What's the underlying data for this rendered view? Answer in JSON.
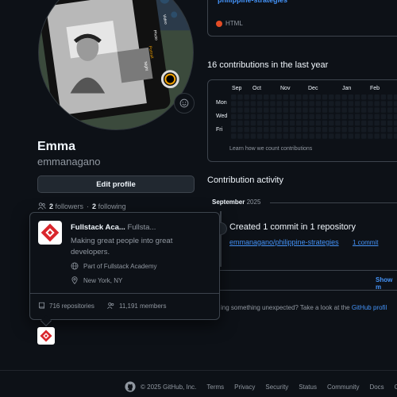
{
  "profile": {
    "name": "Emma",
    "login": "emmanagano",
    "edit_label": "Edit profile",
    "followers_count": "2",
    "followers_label": "followers",
    "separator": "·",
    "following_count": "2",
    "following_label": "following"
  },
  "camera": {
    "modes": [
      "Video",
      "Photo",
      "Portrait",
      "Night"
    ]
  },
  "popover": {
    "org_name": "Fullstack Aca...",
    "org_handle": "Fullsta...",
    "description": "Making great people into great developers.",
    "part_of": "Part of Fullstack Academy",
    "location": "New York, NY",
    "repositories": "716 repositories",
    "members": "11,191 members"
  },
  "pinned": {
    "repo": "philippine-strategies",
    "language": "HTML",
    "language_color": "#e34c26"
  },
  "contributions": {
    "title": "16 contributions in the last year",
    "months": [
      "Sep",
      "Oct",
      "Nov",
      "Dec",
      "Jan",
      "Feb"
    ],
    "days": [
      "Mon",
      "Wed",
      "Fri"
    ],
    "learn": "Learn how we count contributions"
  },
  "activity": {
    "title": "Contribution activity",
    "month": "September",
    "year": "2025",
    "created": "Created 1 commit in 1 repository",
    "repo": "emmanagano/philippine-strategies",
    "commits": "1 commit",
    "show_more": "Show m",
    "unexpected_text": "ing something unexpected? Take a look at the ",
    "unexpected_link": "GitHub profil"
  },
  "footer": {
    "copyright": "© 2025 GitHub, Inc.",
    "links": [
      "Terms",
      "Privacy",
      "Security",
      "Status",
      "Community",
      "Docs",
      "Co"
    ]
  }
}
